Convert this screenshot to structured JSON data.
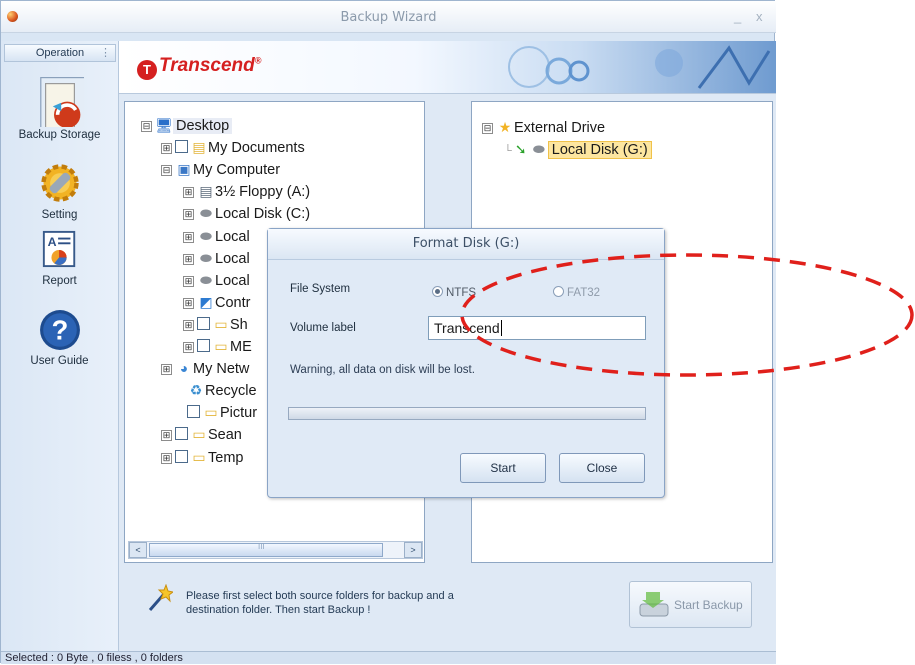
{
  "window": {
    "title": "Backup Wizard",
    "minimize": "_",
    "close": "x"
  },
  "sidebar": {
    "header": "Operation",
    "grip": "⋮",
    "items": [
      {
        "label": "Backup Storage",
        "icon": "backup-storage-icon"
      },
      {
        "label": "Setting",
        "icon": "setting-gear-icon"
      },
      {
        "label": "Report",
        "icon": "report-icon"
      },
      {
        "label": "User Guide",
        "icon": "help-question-icon"
      }
    ]
  },
  "banner": {
    "logo_text": "Transcend",
    "logo_mark": "T",
    "registered": "®"
  },
  "source_tree": {
    "rows": [
      {
        "expander": "⊟",
        "checkbox": false,
        "icon": "desktop-icon",
        "label": "Desktop"
      },
      {
        "expander": "⊞",
        "checkbox": true,
        "icon": "documents-folder-icon",
        "label": "My Documents"
      },
      {
        "expander": "⊟",
        "checkbox": false,
        "icon": "computer-icon",
        "label": "My Computer"
      },
      {
        "expander": "⊞",
        "checkbox": false,
        "icon": "floppy-icon",
        "label": "3½ Floppy (A:)"
      },
      {
        "expander": "⊞",
        "checkbox": false,
        "icon": "disk-icon",
        "label": "Local Disk (C:)"
      },
      {
        "expander": "⊞",
        "checkbox": false,
        "icon": "disk-icon",
        "label": "Local"
      },
      {
        "expander": "⊞",
        "checkbox": false,
        "icon": "disk-icon",
        "label": "Local"
      },
      {
        "expander": "⊞",
        "checkbox": false,
        "icon": "disk-icon",
        "label": "Local"
      },
      {
        "expander": "⊞",
        "checkbox": false,
        "icon": "control-panel-icon",
        "label": "Contr"
      },
      {
        "expander": "⊞",
        "checkbox": true,
        "icon": "folder-icon",
        "label": "Sh"
      },
      {
        "expander": "⊞",
        "checkbox": true,
        "icon": "folder-icon",
        "label": "ME"
      },
      {
        "expander": "⊞",
        "checkbox": false,
        "icon": "network-icon",
        "label": "My Netw"
      },
      {
        "expander": "",
        "checkbox": false,
        "icon": "recycle-bin-icon",
        "label": "Recycle"
      },
      {
        "expander": "",
        "checkbox": true,
        "icon": "folder-icon",
        "label": "Pictur"
      },
      {
        "expander": "⊞",
        "checkbox": true,
        "icon": "folder-icon",
        "label": "Sean"
      },
      {
        "expander": "⊞",
        "checkbox": true,
        "icon": "folder-icon",
        "label": "Temp"
      }
    ],
    "scroll_left": "<",
    "scroll_right": ">",
    "scroll_grip": "III"
  },
  "dest_tree": {
    "root": {
      "expander": "⊟",
      "icon": "star-icon",
      "label": "External Drive"
    },
    "child": {
      "icon": "disk-icon",
      "label": "Local Disk (G:)"
    }
  },
  "hint": "Please first select both source folders for backup and a destination folder. Then start Backup !",
  "start_backup": "Start Backup",
  "status_bar": "Selected : 0 Byte , 0 filess , 0 folders",
  "dialog": {
    "title": "Format Disk (G:)",
    "file_system_label": "File System",
    "options": [
      {
        "label": "NTFS",
        "selected": true
      },
      {
        "label": "FAT32",
        "selected": false
      }
    ],
    "volume_label": "Volume label",
    "volume_value": "Transcend",
    "warning": "Warning, all data on disk will be lost.",
    "progress": 0,
    "start": "Start",
    "close": "Close"
  },
  "colors": {
    "annotation": "#e0201b",
    "brand": "#d52020"
  }
}
